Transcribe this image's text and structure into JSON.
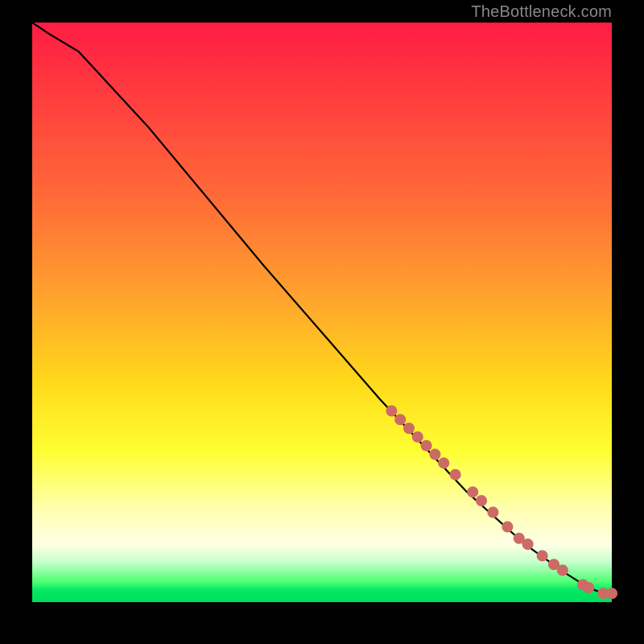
{
  "watermark": "TheBottleneck.com",
  "colors": {
    "page_bg": "#000000",
    "curve": "#000000",
    "dot": "#cc6b66",
    "gradient_top": "#ff1c44",
    "gradient_bottom": "#00de5a"
  },
  "chart_data": {
    "type": "line",
    "title": "",
    "xlabel": "",
    "ylabel": "",
    "xlim": [
      0,
      100
    ],
    "ylim": [
      0,
      100
    ],
    "grid": false,
    "note": "Axes unlabeled; values are approximate pixel-proportional readings on a 0–100 scale.",
    "series": [
      {
        "name": "curve",
        "x": [
          0,
          3,
          8,
          20,
          40,
          60,
          75,
          85,
          92,
          96,
          98.5,
          100
        ],
        "y": [
          100,
          98,
          95,
          82,
          58,
          35,
          19,
          10,
          5,
          2.5,
          1.5,
          1.5
        ]
      }
    ],
    "points": {
      "name": "markers",
      "x": [
        62,
        63.5,
        65,
        66.5,
        68,
        69.5,
        71,
        73,
        76,
        77.5,
        79.5,
        82,
        84,
        85.5,
        88,
        90,
        91.5,
        95,
        96,
        98.5,
        100
      ],
      "y": [
        33,
        31.5,
        30,
        28.5,
        27,
        25.5,
        24,
        22,
        19,
        17.5,
        15.5,
        13,
        11,
        10,
        8,
        6.5,
        5.5,
        3,
        2.5,
        1.5,
        1.5
      ]
    }
  }
}
